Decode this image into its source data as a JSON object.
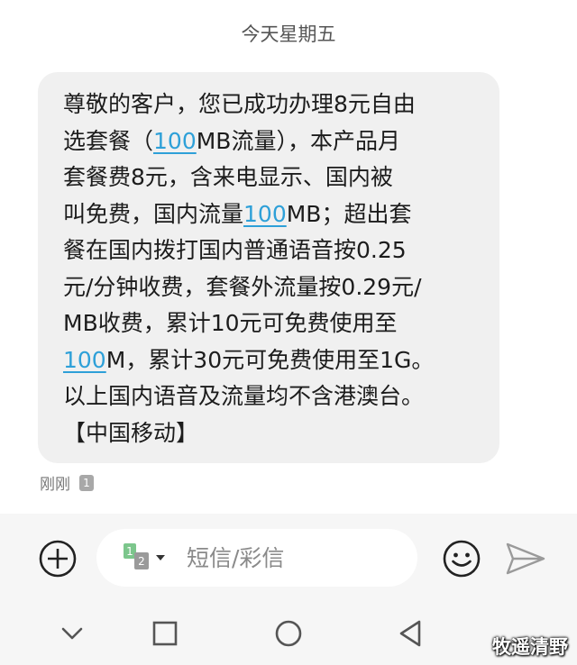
{
  "day_header": "今天星期五",
  "message": {
    "lines": [
      [
        {
          "t": "尊敬的客户，您已成功办理8元自由"
        }
      ],
      [
        {
          "t": "选套餐（"
        },
        {
          "t": "100",
          "link": true
        },
        {
          "t": "MB流量），本产品月"
        }
      ],
      [
        {
          "t": "套餐费8元，含来电显示、国内被"
        }
      ],
      [
        {
          "t": "叫免费，国内流量"
        },
        {
          "t": "100",
          "link": true
        },
        {
          "t": "MB；超出套"
        }
      ],
      [
        {
          "t": "餐在国内拨打国内普通语音按0.25"
        }
      ],
      [
        {
          "t": "元/分钟收费，套餐外流量按0.29元/"
        }
      ],
      [
        {
          "t": "MB收费，累计10元可免费使用至"
        }
      ],
      [
        {
          "t": "100",
          "link": true
        },
        {
          "t": "M，累计30元可免费使用至1G。"
        }
      ],
      [
        {
          "t": "以上国内语音及流量均不含港澳台。"
        }
      ],
      [
        {
          "t": "【中国移动】"
        }
      ]
    ],
    "time": "刚刚",
    "sim": "1"
  },
  "composer": {
    "placeholder": "短信/彩信",
    "sim_primary": "1",
    "sim_secondary": "2"
  },
  "watermark": "牧遥清野",
  "colors": {
    "link": "#2ea0d8",
    "sim_green": "#7cc68c",
    "bubble": "#f0f0f0"
  }
}
